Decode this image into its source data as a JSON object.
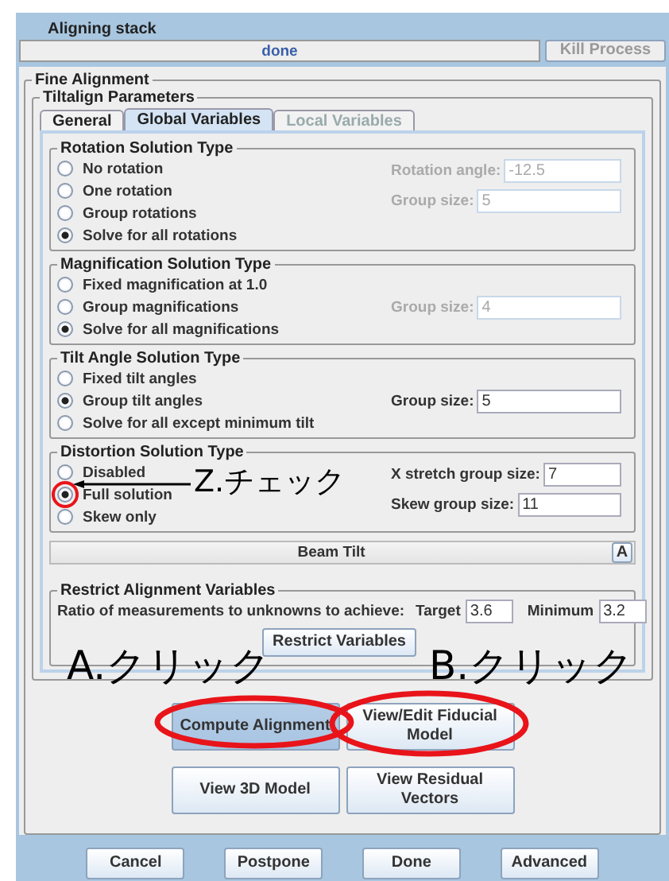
{
  "header": {
    "title": "Aligning stack",
    "progress": "done",
    "kill_button": {
      "label": "Kill Process",
      "disabled": true
    }
  },
  "fine_alignment": {
    "title": "Fine Alignment",
    "tiltalign": {
      "title": "Tiltalign Parameters",
      "tabs": [
        {
          "label": "General",
          "selected": false,
          "disabled": false
        },
        {
          "label": "Global Variables",
          "selected": true,
          "disabled": false
        },
        {
          "label": "Local Variables",
          "selected": false,
          "disabled": true
        }
      ],
      "sections": [
        {
          "title": "Rotation Solution Type",
          "options": [
            {
              "label": "No rotation",
              "selected": false
            },
            {
              "label": "One rotation",
              "selected": false
            },
            {
              "label": "Group rotations",
              "selected": false
            },
            {
              "label": "Solve for all rotations",
              "selected": true
            }
          ],
          "fields": [
            {
              "label": "Rotation angle:",
              "value": "-12.5",
              "disabled": true
            },
            {
              "label": "Group size:",
              "value": "5",
              "disabled": true
            }
          ]
        },
        {
          "title": "Magnification Solution Type",
          "options": [
            {
              "label": "Fixed magnification at 1.0",
              "selected": false
            },
            {
              "label": "Group magnifications",
              "selected": false
            },
            {
              "label": "Solve for all magnifications",
              "selected": true
            }
          ],
          "fields": [
            {
              "label": "Group size:",
              "value": "4",
              "disabled": true
            }
          ]
        },
        {
          "title": "Tilt Angle Solution Type",
          "options": [
            {
              "label": "Fixed tilt angles",
              "selected": false
            },
            {
              "label": "Group tilt angles",
              "selected": true
            },
            {
              "label": "Solve for all except minimum tilt",
              "selected": false
            }
          ],
          "fields": [
            {
              "label": "Group size:",
              "value": "5",
              "disabled": false
            }
          ]
        },
        {
          "title": "Distortion Solution Type",
          "options": [
            {
              "label": "Disabled",
              "selected": false
            },
            {
              "label": "Full solution",
              "selected": true
            },
            {
              "label": "Skew only",
              "selected": false
            }
          ],
          "fields": [
            {
              "label": "X stretch group size:",
              "value": "7",
              "disabled": false
            },
            {
              "label": "Skew group size:",
              "value": "11",
              "disabled": false
            }
          ]
        }
      ],
      "beam_tilt": {
        "label": "Beam Tilt",
        "button": "A"
      },
      "restrict": {
        "title": "Restrict Alignment Variables",
        "ratio_label": "Ratio of measurements to unknowns to achieve:",
        "target_label": "Target",
        "target": "3.6",
        "minimum_label": "Minimum",
        "minimum": "3.2",
        "button": "Restrict Variables"
      }
    }
  },
  "actions": [
    [
      {
        "label": "Compute Alignment",
        "pressed": true
      },
      {
        "label": "View/Edit Fiducial Model",
        "pressed": false
      }
    ],
    [
      {
        "label": "View 3D Model",
        "pressed": false
      },
      {
        "label": "View Residual Vectors",
        "pressed": false
      }
    ]
  ],
  "footer": [
    "Cancel",
    "Postpone",
    "Done",
    "Advanced"
  ],
  "annotations": [
    {
      "kind": "circle"
    },
    {
      "kind": "arrow"
    },
    {
      "kind": "label",
      "text": "Z.チェック"
    },
    {
      "kind": "label",
      "text": "A.クリック"
    },
    {
      "kind": "label",
      "text": "B.クリック"
    },
    {
      "kind": "ellipse"
    },
    {
      "kind": "ellipse"
    }
  ]
}
